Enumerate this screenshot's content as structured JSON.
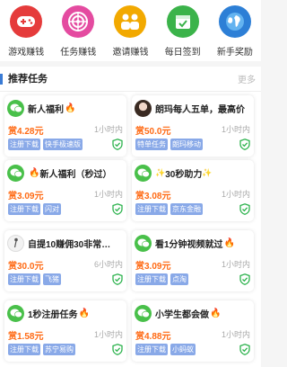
{
  "nav": [
    {
      "label": "游戏赚钱",
      "icon": "gamepad-icon",
      "color": "#e53b3b"
    },
    {
      "label": "任务赚钱",
      "icon": "target-icon",
      "color": "#e44ba0"
    },
    {
      "label": "邀请赚钱",
      "icon": "users-icon",
      "color": "#f2a900"
    },
    {
      "label": "每日签到",
      "icon": "calendar-check-icon",
      "color": "#3bb34a"
    },
    {
      "label": "新手奖励",
      "icon": "globe-icon",
      "color": "#2d7fd6"
    }
  ],
  "section": {
    "title": "推荐任务",
    "more": "更多"
  },
  "cards": [
    {
      "title": "新人福利",
      "fire_before": false,
      "fire_after": true,
      "avatar": "wechat",
      "reward": "赏4.28元",
      "time": "1小时内",
      "tags": [
        "注册下载",
        "快手极速版"
      ]
    },
    {
      "title": "朗玛每人五单，最高价",
      "fire_before": false,
      "fire_after": false,
      "avatar": "photo",
      "reward": "赏50.0元",
      "time": "1小时内",
      "tags": [
        "特单任务",
        "朗玛移动"
      ]
    },
    {
      "title": "新人福利（秒过）",
      "fire_before": true,
      "fire_after": false,
      "avatar": "wechat",
      "reward": "赏3.09元",
      "time": "1小时内",
      "tags": [
        "注册下载",
        "闪对"
      ]
    },
    {
      "title": "30秒助力",
      "fire_before": false,
      "fire_after": false,
      "sparkle": true,
      "avatar": "wechat",
      "reward": "赏3.08元",
      "time": "1小时内",
      "tags": [
        "注册下载",
        "京东金融"
      ]
    },
    {
      "title": "自提10赚佣30非常…",
      "fire_before": false,
      "fire_after": false,
      "avatar": "stick",
      "reward": "赏30.0元",
      "time": "6小时内",
      "tags": [
        "注册下载",
        "飞猪"
      ]
    },
    {
      "title": "看1分钟视频就过",
      "fire_before": false,
      "fire_after": true,
      "avatar": "wechat",
      "reward": "赏3.09元",
      "time": "1小时内",
      "tags": [
        "注册下载",
        "点淘"
      ]
    },
    {
      "title": "1秒注册任务",
      "fire_before": false,
      "fire_after": true,
      "avatar": "wechat",
      "reward": "赏1.58元",
      "time": "1小时内",
      "tags": [
        "注册下载",
        "苏宁易购"
      ]
    },
    {
      "title": "小学生都会做",
      "fire_before": false,
      "fire_after": true,
      "avatar": "wechat",
      "reward": "赏4.88元",
      "time": "1小时内",
      "tags": [
        "注册下载",
        "小蚂蚁"
      ]
    }
  ]
}
